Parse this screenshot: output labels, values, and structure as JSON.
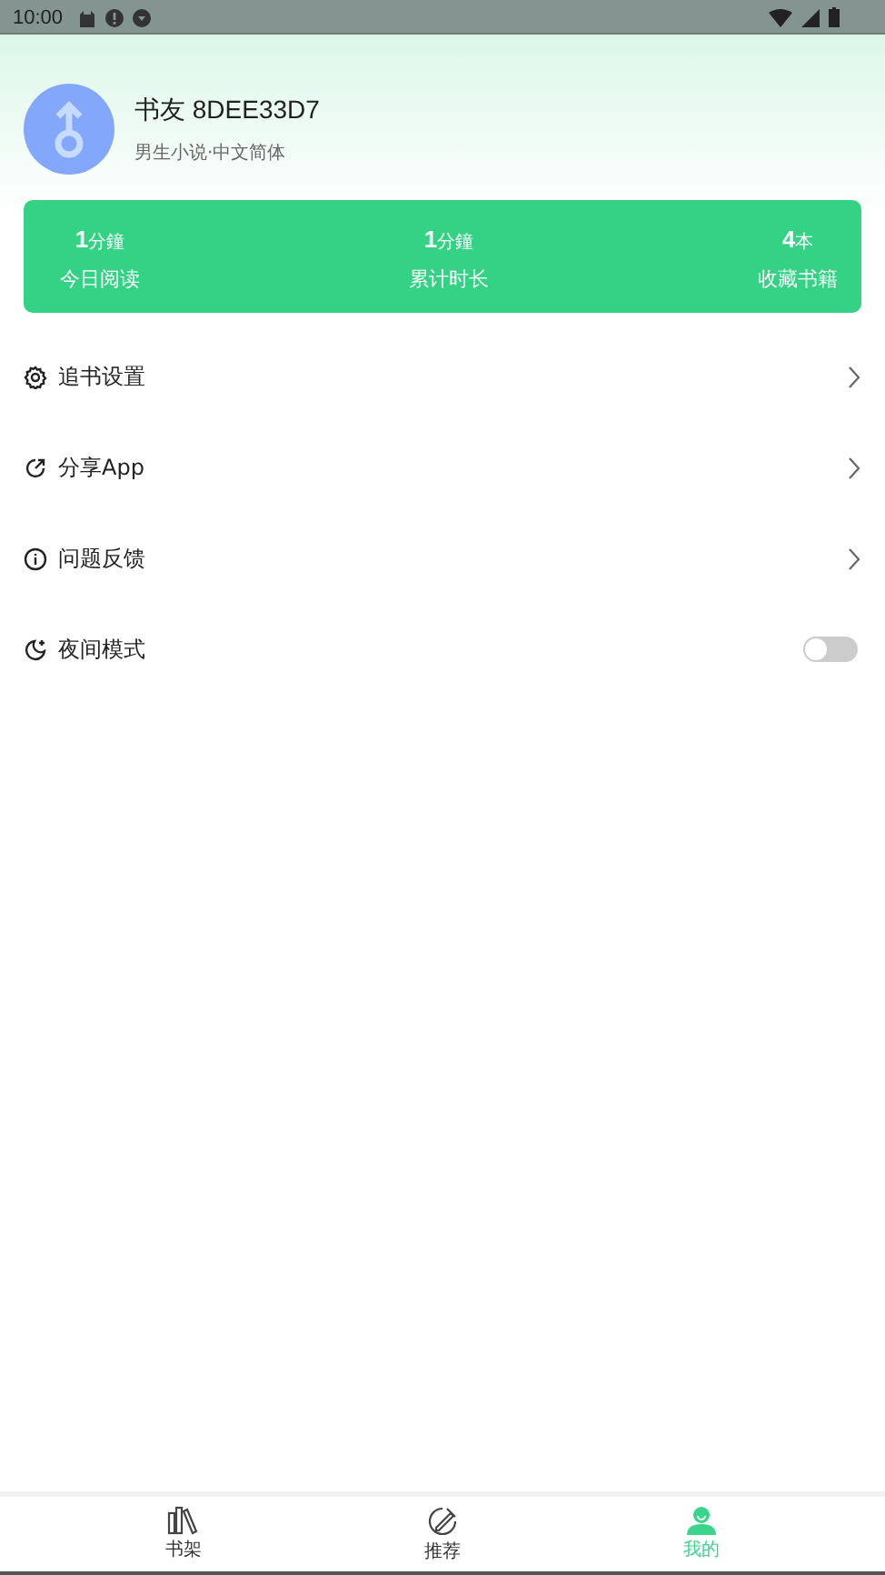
{
  "status_bar": {
    "time": "10:00"
  },
  "profile": {
    "name": "书友 8DEE33D7",
    "subtitle": "男生小说·中文简体"
  },
  "stats": [
    {
      "value": "1",
      "unit": "分鐘",
      "label": "今日阅读"
    },
    {
      "value": "1",
      "unit": "分鐘",
      "label": "累计时长"
    },
    {
      "value": "4",
      "unit": "本",
      "label": "收藏书籍"
    }
  ],
  "menu": [
    {
      "kind": "link",
      "label": "追书设置"
    },
    {
      "kind": "link",
      "label": "分享App"
    },
    {
      "kind": "link",
      "label": "问题反馈"
    },
    {
      "kind": "toggle",
      "label": "夜间模式",
      "on": false
    }
  ],
  "tabs": [
    {
      "label": "书架",
      "selected": false
    },
    {
      "label": "推荐",
      "selected": false
    },
    {
      "label": "我的",
      "selected": true
    }
  ]
}
